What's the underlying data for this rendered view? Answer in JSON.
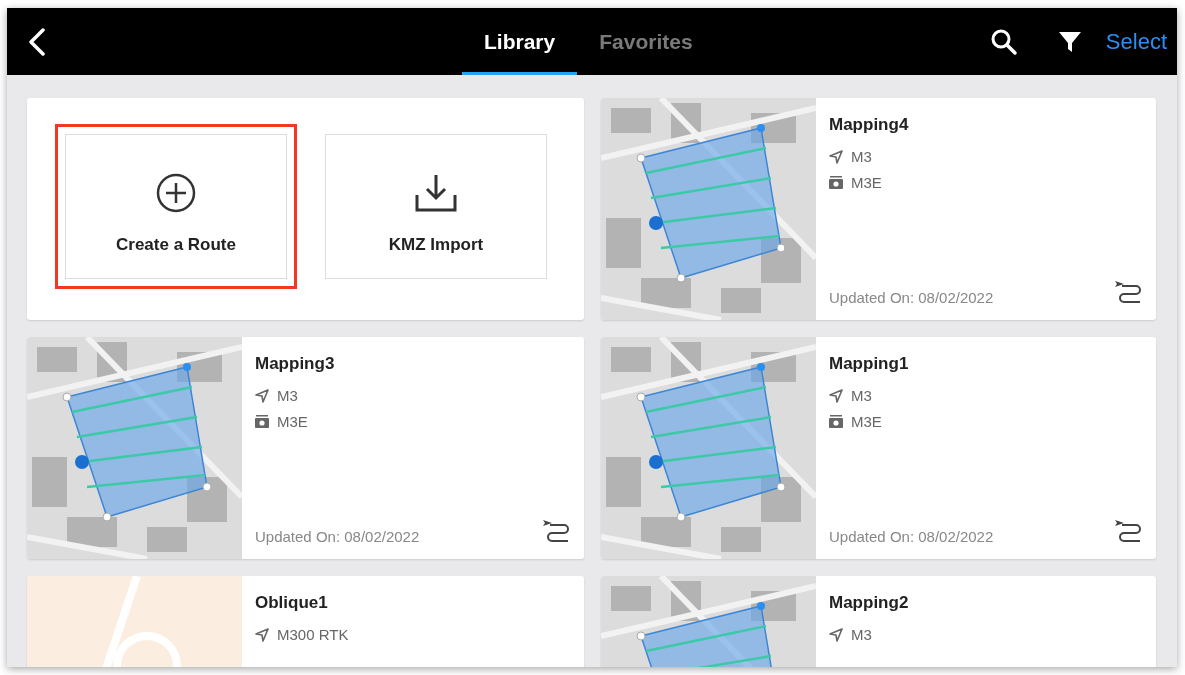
{
  "top_bar": {
    "tabs": [
      {
        "label": "Library",
        "selected": true
      },
      {
        "label": "Favorites",
        "selected": false
      }
    ],
    "select_action": "Select"
  },
  "actions": [
    {
      "kind": "create",
      "label": "Create a Route",
      "highlighted": true
    },
    {
      "kind": "import",
      "label": "KMZ Import",
      "highlighted": false
    }
  ],
  "routes": [
    {
      "kind": "mapping",
      "name": "Mapping4",
      "aircraft": "M3",
      "camera": "M3E",
      "updated": "Updated On: 08/02/2022"
    },
    {
      "kind": "mapping",
      "name": "Mapping3",
      "aircraft": "M3",
      "camera": "M3E",
      "updated": "Updated On: 08/02/2022"
    },
    {
      "kind": "mapping",
      "name": "Mapping1",
      "aircraft": "M3",
      "camera": "M3E",
      "updated": "Updated On: 08/02/2022"
    },
    {
      "kind": "oblique",
      "name": "Oblique1",
      "aircraft": "M300 RTK"
    },
    {
      "kind": "mapping",
      "name": "Mapping2",
      "aircraft": "M3"
    }
  ]
}
